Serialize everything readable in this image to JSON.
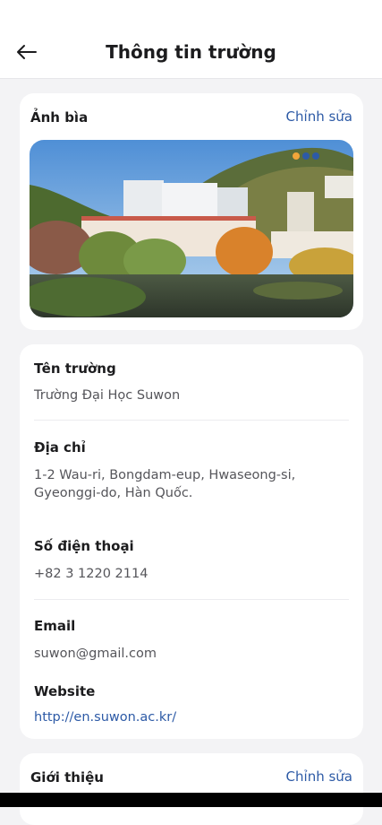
{
  "header": {
    "title": "Thông tin trường",
    "back_icon": "arrow-left-icon"
  },
  "cover": {
    "title": "Ảnh bìa",
    "edit_label": "Chỉnh sửa",
    "dots_colors": [
      "#f2a53a",
      "#2d5aa6",
      "#2d5aa6"
    ]
  },
  "info": {
    "name_label": "Tên trường",
    "name_value": "Trường Đại Học Suwon",
    "address_label": "Địa chỉ",
    "address_line1": "1-2 Wau-ri, Bongdam-eup, Hwaseong-si,",
    "address_line2": "Gyeonggi-do, Hàn Quốc.",
    "phone_label": "Số điện thoại",
    "phone_value": "+82 3 1220 2114",
    "email_label": "Email",
    "email_value": "suwon@gmail.com",
    "website_label": "Website",
    "website_value": "http://en.suwon.ac.kr/"
  },
  "intro": {
    "title": "Giới thiệu",
    "edit_label": "Chỉnh sửa"
  },
  "colors": {
    "accent": "#2d5aa6",
    "background": "#f3f3f5"
  }
}
